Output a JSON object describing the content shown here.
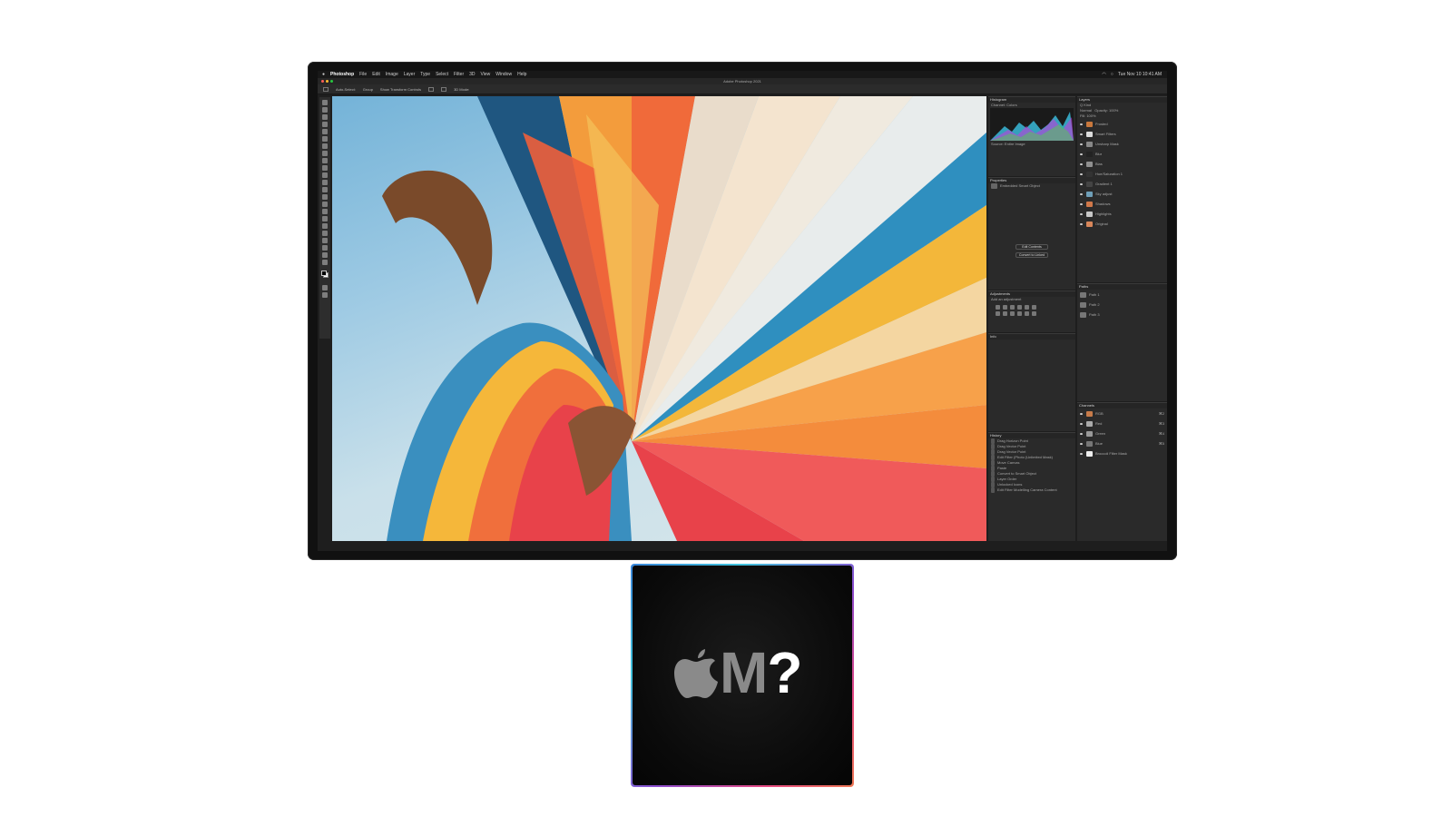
{
  "menubar": {
    "app": "Photoshop",
    "items": [
      "File",
      "Edit",
      "Image",
      "Layer",
      "Type",
      "Select",
      "Filter",
      "3D",
      "View",
      "Window",
      "Help"
    ],
    "clock": "Tue Nov 10  10:41 AM"
  },
  "window": {
    "title": "Adobe Photoshop 2021"
  },
  "options_bar": {
    "auto_select": "Auto-Select:",
    "target": "Group",
    "show_transform": "Show Transform Controls",
    "mode": "3D Mode:"
  },
  "panels": {
    "histogram": {
      "title": "Histogram",
      "channel_label": "Channel:",
      "channel_value": "Colors",
      "source_label": "Source:",
      "source_value": "Entire Image"
    },
    "properties": {
      "title": "Properties",
      "layer_kind": "Embedded Smart Object",
      "edit_contents": "Edit Contents",
      "convert_linked": "Convert to Linked"
    },
    "adjustments": {
      "title": "Adjustments",
      "subtitle": "Add an adjustment"
    },
    "info": {
      "title": "Info"
    },
    "history": {
      "title": "History",
      "items": [
        "Drag Horizon Point",
        "Drag Vector Point",
        "Drag Vector Point",
        "Edit Filter (Photo (Unlimited Mask)",
        "Move Canvas",
        "Paste",
        "Convert to Smart Object",
        "Layer Order",
        "Unlocked Icons",
        "Edit Filter Modelling Camera Content"
      ]
    },
    "layers": {
      "title": "Layers",
      "kind": "Q Kind",
      "blend": "Normal",
      "opacity": "Opacity: 100%",
      "fill": "Fill: 100%",
      "items": [
        {
          "name": "Frosted",
          "thumb": "#c9783d"
        },
        {
          "name": "Smart Filters",
          "thumb": "#dddddd"
        },
        {
          "name": "Unsharp Mask",
          "thumb": "#888888"
        },
        {
          "name": "Blur",
          "thumb": "#222222"
        },
        {
          "name": "Bias",
          "thumb": "#8f8f8f"
        },
        {
          "name": "Hue/Saturation 1",
          "thumb": "#333333"
        },
        {
          "name": "Gradient 1",
          "thumb": "#444444"
        },
        {
          "name": "Sky adjust",
          "thumb": "#6f9fb8"
        },
        {
          "name": "Shadows",
          "thumb": "#d0784a"
        },
        {
          "name": "Highlights",
          "thumb": "#c8c8c8"
        },
        {
          "name": "Original",
          "thumb": "#d8875b"
        }
      ]
    },
    "paths": {
      "title": "Paths",
      "items": [
        "Path 1",
        "Path 2",
        "Path 3"
      ]
    },
    "channels": {
      "title": "Channels",
      "items": [
        {
          "name": "RGB",
          "key": "⌘2",
          "thumb": "#c77b4a"
        },
        {
          "name": "Red",
          "key": "⌘3",
          "thumb": "#aaaaaa"
        },
        {
          "name": "Green",
          "key": "⌘4",
          "thumb": "#999999"
        },
        {
          "name": "Blue",
          "key": "⌘5",
          "thumb": "#777777"
        },
        {
          "name": "Broccoli Filter Mask",
          "key": "",
          "thumb": "#eeeeee"
        }
      ]
    }
  },
  "chip": {
    "glyph_name": "apple-logo",
    "label_main": "M",
    "label_q": "?"
  }
}
